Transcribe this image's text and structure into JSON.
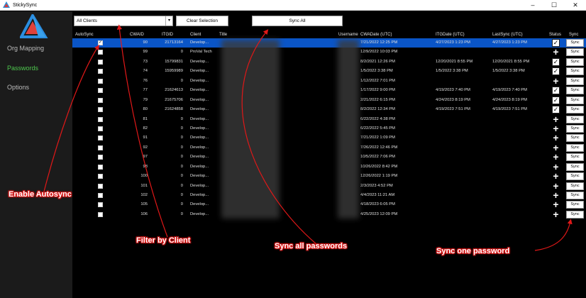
{
  "window": {
    "title": "StickySync",
    "controls": [
      "–",
      "☐",
      "✕"
    ]
  },
  "sidebar": {
    "items": [
      {
        "label": "Org Mapping",
        "active": false
      },
      {
        "label": "Passwords",
        "active": true
      },
      {
        "label": "Options",
        "active": false
      }
    ]
  },
  "toolbar": {
    "client_filter": "All Clients",
    "clear_label": "Clear Selection",
    "sync_all_label": "Sync All"
  },
  "table": {
    "headers": {
      "autosync": "AutoSync",
      "cwaid": "CWAID",
      "itgid": "ITGID",
      "client": "Client",
      "title": "Title",
      "username": "Username",
      "cwadate": "CWADate (UTC)",
      "itgdate": "ITGDate (UTC)",
      "lastsync": "LastSync (UTC)",
      "status": "Status",
      "sync": "Sync"
    },
    "sync_label": "Sync",
    "rows": [
      {
        "autosync": true,
        "cwaid": "90",
        "itgid": "21713164",
        "client": "Develop...",
        "cwadate": "7/21/2022 12:25 PM",
        "itgdate": "4/27/2023 1:23 PM",
        "lastsync": "4/27/2023 1:23 PM",
        "status": "check",
        "selected": true
      },
      {
        "autosync": false,
        "cwaid": "99",
        "itgid": "0",
        "client": "ProVal Tech",
        "cwadate": "12/9/2022 10:03 PM",
        "itgdate": "",
        "lastsync": "",
        "status": "plus",
        "selected": false
      },
      {
        "autosync": false,
        "cwaid": "73",
        "itgid": "15799831",
        "client": "Develop...",
        "cwadate": "8/2/2021 12:26 PM",
        "itgdate": "12/20/2021 8:55 PM",
        "lastsync": "12/20/2021 8:55 PM",
        "status": "check",
        "selected": false
      },
      {
        "autosync": false,
        "cwaid": "74",
        "itgid": "15959989",
        "client": "Develop...",
        "cwadate": "1/5/2022 3:38 PM",
        "itgdate": "1/5/2022 3:38 PM",
        "lastsync": "1/5/2022 3:38 PM",
        "status": "check",
        "selected": false
      },
      {
        "autosync": false,
        "cwaid": "76",
        "itgid": "0",
        "client": "Develop...",
        "cwadate": "1/12/2022 7:01 PM",
        "itgdate": "",
        "lastsync": "",
        "status": "plus",
        "selected": false
      },
      {
        "autosync": false,
        "cwaid": "77",
        "itgid": "21624613",
        "client": "Develop...",
        "cwadate": "1/17/2022 9:00 PM",
        "itgdate": "4/19/2023 7:40 PM",
        "lastsync": "4/19/2023 7:40 PM",
        "status": "check",
        "selected": false
      },
      {
        "autosync": false,
        "cwaid": "79",
        "itgid": "21675706",
        "client": "Develop...",
        "cwadate": "2/21/2022 6:15 PM",
        "itgdate": "4/24/2023 8:19 PM",
        "lastsync": "4/24/2023 8:19 PM",
        "status": "check",
        "selected": false
      },
      {
        "autosync": false,
        "cwaid": "80",
        "itgid": "21624858",
        "client": "Develop...",
        "cwadate": "8/2/2022 12:34 PM",
        "itgdate": "4/19/2023 7:51 PM",
        "lastsync": "4/19/2023 7:51 PM",
        "status": "check",
        "selected": false
      },
      {
        "autosync": false,
        "cwaid": "81",
        "itgid": "0",
        "client": "Develop...",
        "cwadate": "6/22/2022 4:38 PM",
        "itgdate": "",
        "lastsync": "",
        "status": "plus",
        "selected": false
      },
      {
        "autosync": false,
        "cwaid": "82",
        "itgid": "0",
        "client": "Develop...",
        "cwadate": "6/22/2022 5:45 PM",
        "itgdate": "",
        "lastsync": "",
        "status": "plus",
        "selected": false
      },
      {
        "autosync": false,
        "cwaid": "91",
        "itgid": "0",
        "client": "Develop...",
        "cwadate": "7/21/2022 1:09 PM",
        "itgdate": "",
        "lastsync": "",
        "status": "plus",
        "selected": false
      },
      {
        "autosync": false,
        "cwaid": "92",
        "itgid": "0",
        "client": "Develop...",
        "cwadate": "7/26/2022 12:46 PM",
        "itgdate": "",
        "lastsync": "",
        "status": "plus",
        "selected": false
      },
      {
        "autosync": false,
        "cwaid": "97",
        "itgid": "0",
        "client": "Develop...",
        "cwadate": "10/5/2022 7:06 PM",
        "itgdate": "",
        "lastsync": "",
        "status": "plus",
        "selected": false
      },
      {
        "autosync": false,
        "cwaid": "98",
        "itgid": "0",
        "client": "Develop...",
        "cwadate": "10/26/2022 8:42 PM",
        "itgdate": "",
        "lastsync": "",
        "status": "plus",
        "selected": false
      },
      {
        "autosync": false,
        "cwaid": "100",
        "itgid": "0",
        "client": "Develop...",
        "cwadate": "12/26/2022 1:19 PM",
        "itgdate": "",
        "lastsync": "",
        "status": "plus",
        "selected": false
      },
      {
        "autosync": false,
        "cwaid": "101",
        "itgid": "0",
        "client": "Develop...",
        "cwadate": "2/3/2023 4:52 PM",
        "itgdate": "",
        "lastsync": "",
        "status": "plus",
        "selected": false
      },
      {
        "autosync": false,
        "cwaid": "102",
        "itgid": "0",
        "client": "Develop...",
        "cwadate": "4/4/2023 11:21 AM",
        "itgdate": "",
        "lastsync": "",
        "status": "plus",
        "selected": false
      },
      {
        "autosync": false,
        "cwaid": "105",
        "itgid": "0",
        "client": "Develop...",
        "cwadate": "4/18/2023 6:05 PM",
        "itgdate": "",
        "lastsync": "",
        "status": "plus",
        "selected": false
      },
      {
        "autosync": false,
        "cwaid": "106",
        "itgid": "0",
        "client": "Develop...",
        "cwadate": "4/25/2023 12:09 PM",
        "itgdate": "",
        "lastsync": "",
        "status": "plus",
        "selected": false
      }
    ]
  },
  "callouts": {
    "enable_autosync": "Enable Autosync",
    "filter_by_client": "Filter by Client",
    "sync_all_passwords": "Sync all passwords",
    "sync_one_password": "Sync one password"
  },
  "colors": {
    "accent_green": "#4ec84e",
    "selection_blue": "#0a55c7",
    "callout_red": "#e01818"
  }
}
